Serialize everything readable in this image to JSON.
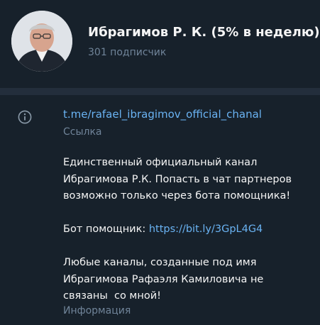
{
  "header": {
    "channel_name": "Ибрагимов Р. К. (5% в неделю)",
    "subscribers": "301 подписчик"
  },
  "info": {
    "link": "t.me/rafael_ibragimov_official_chanal",
    "link_label": "Ссылка",
    "description_p1": "Единственный официальный канал\nИбрагимова Р.К. Попасть в чат партнеров\nвозможно только через бота помощника!",
    "bot_prefix": "Бот помощник: ",
    "bot_link": "https://bit.ly/3GpL4G4",
    "description_p2": "Любые каналы, созданные под имя\nИбрагимова Рафаэля Камиловича не\nсвязаны  со мной!",
    "info_label": "Информация"
  },
  "icons": {
    "info": "info-icon"
  },
  "colors": {
    "background": "#17212b",
    "divider": "#232e3c",
    "link": "#6ab3f3",
    "secondary_text": "#708499"
  }
}
